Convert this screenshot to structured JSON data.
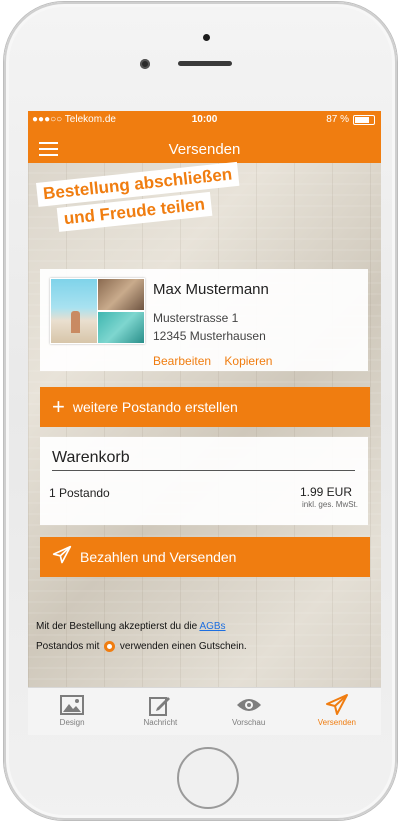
{
  "status": {
    "carrier": "●●●○○ Telekom.de",
    "time": "10:00",
    "battery": "87 %",
    "battery_level": 0.87
  },
  "header": {
    "title": "Versenden"
  },
  "banner": {
    "line1": "Bestellung abschließen",
    "line2": "und Freude teilen"
  },
  "recipient": {
    "name": "Max Mustermann",
    "street": "Musterstrasse 1",
    "city": "12345 Musterhausen",
    "edit_label": "Bearbeiten",
    "copy_label": "Kopieren"
  },
  "add_button": {
    "label": "weitere Postando erstellen"
  },
  "cart": {
    "title": "Warenkorb",
    "item": "1 Postando",
    "price": "1.99 EUR",
    "tax_note": "inkl. ges. MwSt."
  },
  "pay_button": {
    "label": "Bezahlen und Versenden"
  },
  "terms": {
    "text_before": "Mit der Bestellung akzeptierst du die ",
    "agb_link": "AGBs",
    "coupon_before": "Postandos mit ",
    "coupon_after": " verwenden einen Gutschein."
  },
  "tabs": [
    {
      "label": "Design",
      "icon": "image-icon"
    },
    {
      "label": "Nachricht",
      "icon": "edit-icon"
    },
    {
      "label": "Vorschau",
      "icon": "eye-icon"
    },
    {
      "label": "Versenden",
      "icon": "send-icon",
      "active": true
    }
  ],
  "colors": {
    "accent": "#f07d10",
    "link": "#1e6fe0"
  }
}
